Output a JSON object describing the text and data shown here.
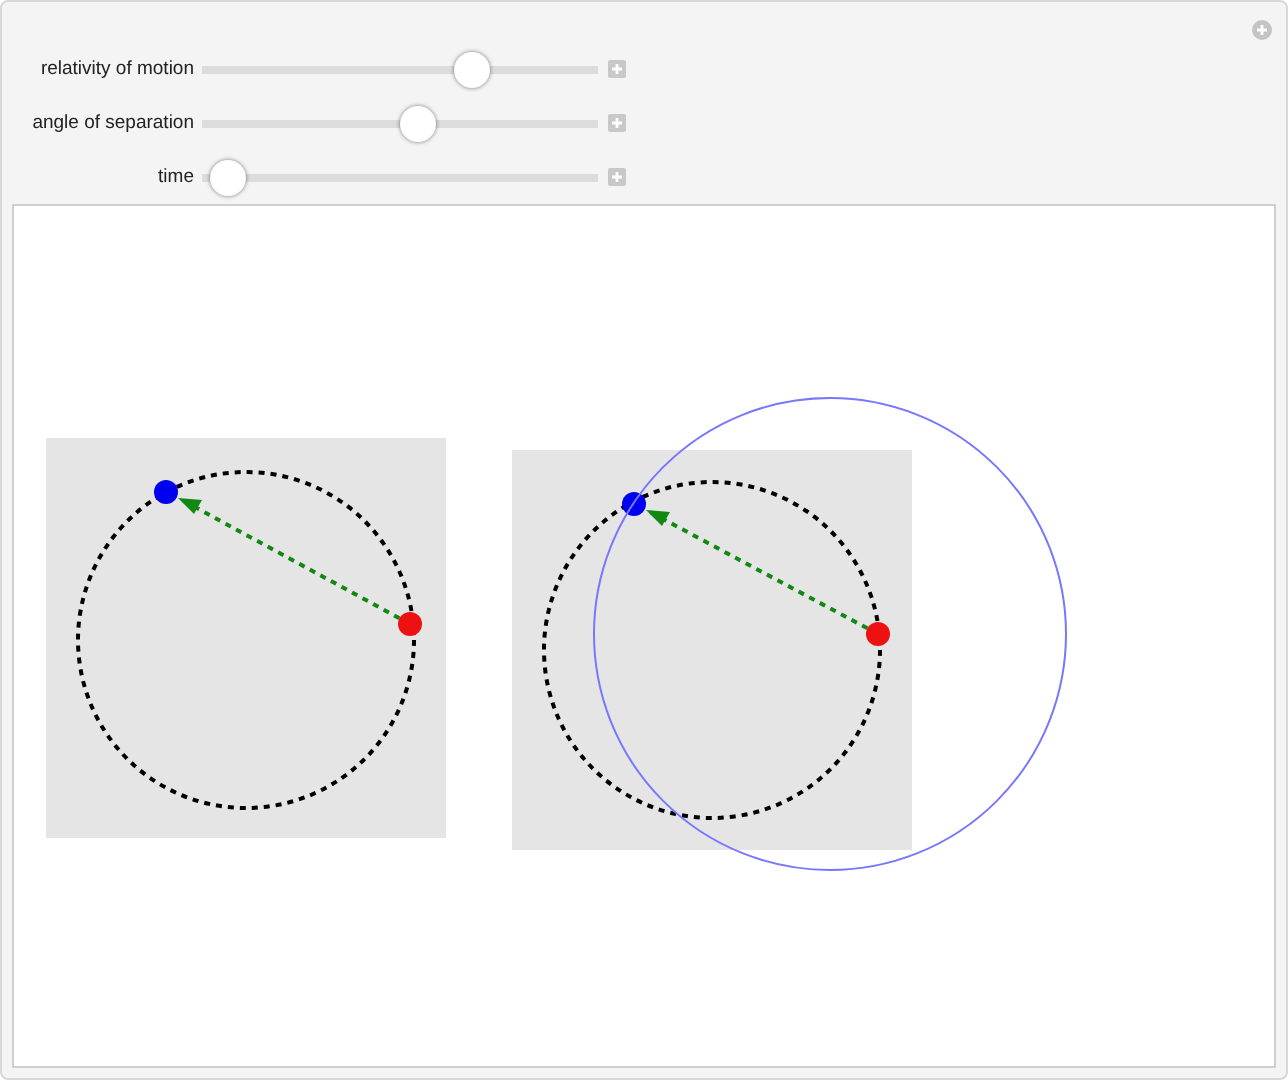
{
  "controls": [
    {
      "label": "relativity of motion",
      "level": 0.7
    },
    {
      "label": "angle of separation",
      "level": 0.55
    },
    {
      "label": "time",
      "level": 0.02
    }
  ]
}
